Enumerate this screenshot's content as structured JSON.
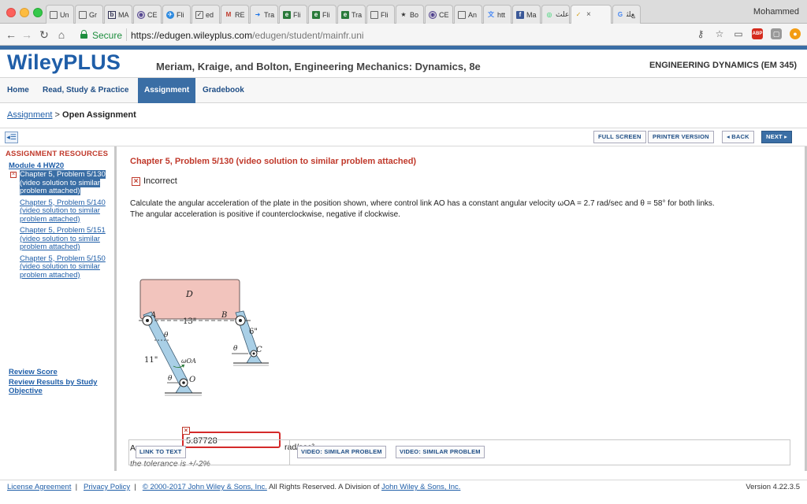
{
  "browser": {
    "tabs": [
      {
        "label": "Un",
        "icon": "doc"
      },
      {
        "label": "Gr",
        "icon": "doc"
      },
      {
        "label": "MA",
        "icon": "b-box"
      },
      {
        "label": "CE",
        "icon": "seal"
      },
      {
        "label": "Fli",
        "icon": "plane"
      },
      {
        "label": "ed",
        "icon": "check"
      },
      {
        "label": "RE",
        "icon": "m"
      },
      {
        "label": "Tra",
        "icon": "arrow"
      },
      {
        "label": "Fli",
        "icon": "e"
      },
      {
        "label": "Fli",
        "icon": "e"
      },
      {
        "label": "Tra",
        "icon": "e"
      },
      {
        "label": "Fli",
        "icon": "doc"
      },
      {
        "label": "Bo",
        "icon": "star"
      },
      {
        "label": "CE",
        "icon": "seal"
      },
      {
        "label": "An",
        "icon": "doc"
      },
      {
        "label": "htt",
        "icon": "translate"
      },
      {
        "label": "Ma",
        "icon": "facebook"
      },
      {
        "label": "علث",
        "icon": "whatsapp"
      },
      {
        "label": "",
        "icon": "check-yellow",
        "active": true
      },
      {
        "label": "ﻊﻠﺜ",
        "icon": "google"
      }
    ],
    "user_name": "Mohammed",
    "secure_label": "Secure",
    "url_base": "https://edugen.wileyplus.com",
    "url_path": "/edugen/student/mainfr.uni"
  },
  "header": {
    "logo": "WileyPLUS",
    "book_title": "Meriam, Kraige, and Bolton, Engineering Mechanics: Dynamics, 8e",
    "course_title": "ENGINEERING DYNAMICS (EM 345)"
  },
  "nav": {
    "home": "Home",
    "read": "Read, Study & Practice",
    "assignment": "Assignment",
    "gradebook": "Gradebook"
  },
  "breadcrumb": {
    "link": "Assignment",
    "separator": ">",
    "current": "Open Assignment"
  },
  "toolbar": {
    "full_screen": "FULL SCREEN",
    "printer": "PRINTER VERSION",
    "back": "◂ BACK",
    "next": "NEXT ▸"
  },
  "sidebar": {
    "title": "ASSIGNMENT RESOURCES",
    "module": "Module 4 HW20",
    "items": [
      {
        "label": "Chapter 5, Problem 5/130 (video solution to similar problem attached)",
        "current": true,
        "status": "incorrect"
      },
      {
        "label": "Chapter 5, Problem 5/140 (video solution to similar problem attached)"
      },
      {
        "label": "Chapter 5, Problem 5/151 (video solution to similar problem attached)"
      },
      {
        "label": "Chapter 5, Problem 5/150 (video solution to similar problem attached)"
      }
    ],
    "review_score": "Review Score",
    "review_results": "Review Results by Study Objective"
  },
  "problem": {
    "title": "Chapter 5, Problem 5/130 (video solution to similar problem attached)",
    "status": "Incorrect",
    "question_line1": "Calculate the angular acceleration of the plate in the position shown, where control link AO has a constant angular velocity ωOA = 2.7 rad/sec and θ = 58° for both links.",
    "question_line2": "The angular acceleration is positive if counterclockwise, negative if clockwise.",
    "diagram": {
      "plate": "D",
      "point_a": "A",
      "point_b": "B",
      "point_c": "C",
      "point_o": "O",
      "dim_ab": "13\"",
      "dim_bc": "6\"",
      "dim_ao": "11\"",
      "theta": "θ",
      "omega": "ωOA"
    },
    "answer_label": "Answer: α =",
    "answer_value": "5.87728",
    "units": "rad/sec²",
    "tolerance": "the tolerance is +/-2%"
  },
  "bottom": {
    "link_to_text": "LINK TO TEXT",
    "video1": "VIDEO: SIMILAR PROBLEM",
    "video2": "VIDEO: SIMILAR PROBLEM"
  },
  "footer": {
    "license": "License Agreement",
    "privacy": "Privacy Policy",
    "copyright": "© 2000-2017 John Wiley & Sons, Inc.",
    "rights": "All Rights Reserved. A Division of",
    "company": "John Wiley & Sons, Inc.",
    "version": "Version 4.22.3.5"
  },
  "colors": {
    "brand_blue": "#1f5ea8",
    "nav_active": "#3a6ea5",
    "error_red": "#c0392b",
    "plate_fill": "#f2c4bd"
  }
}
